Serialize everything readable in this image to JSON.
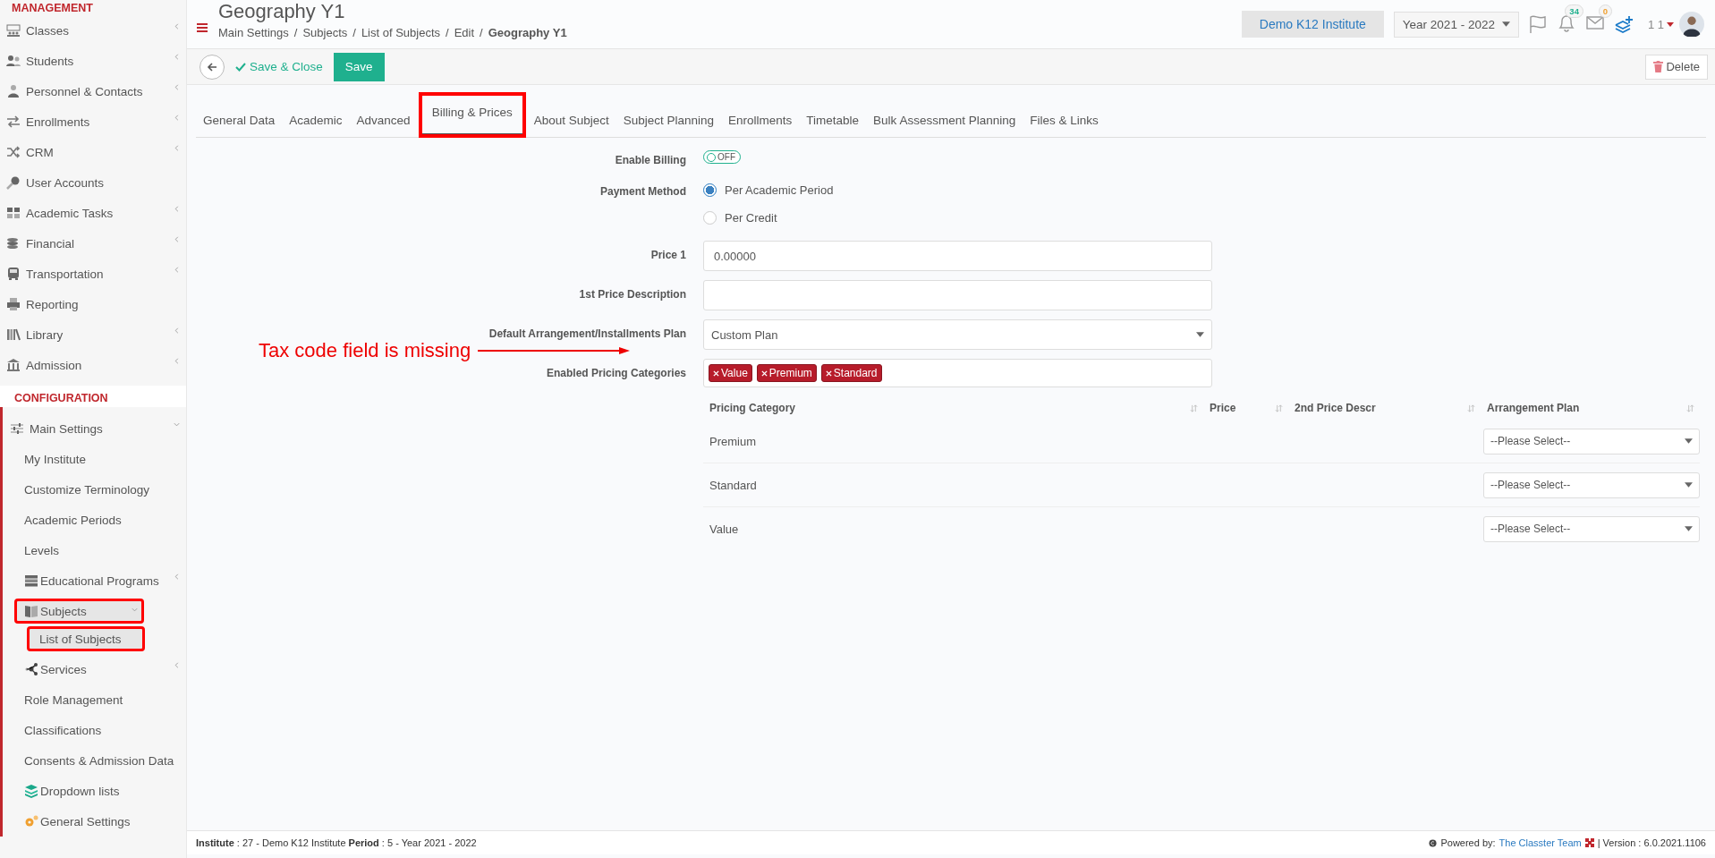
{
  "sidebar": {
    "sections": [
      {
        "title": "MANAGEMENT",
        "items": [
          {
            "label": "Classes",
            "has_icon": true,
            "submenu": true,
            "expanded": false,
            "selected": false,
            "highlighted": false
          },
          {
            "label": "Students",
            "has_icon": true,
            "submenu": true,
            "expanded": false,
            "selected": false,
            "highlighted": false
          },
          {
            "label": "Personnel & Contacts",
            "has_icon": true,
            "submenu": true,
            "expanded": false,
            "selected": false,
            "highlighted": false
          },
          {
            "label": "Enrollments",
            "has_icon": true,
            "submenu": true,
            "expanded": false,
            "selected": false,
            "highlighted": false
          },
          {
            "label": "CRM",
            "has_icon": true,
            "submenu": true,
            "expanded": false,
            "selected": false,
            "highlighted": false
          },
          {
            "label": "User Accounts",
            "has_icon": true,
            "submenu": false,
            "expanded": false,
            "selected": false,
            "highlighted": false
          },
          {
            "label": "Academic Tasks",
            "has_icon": true,
            "submenu": true,
            "expanded": false,
            "selected": false,
            "highlighted": false
          },
          {
            "label": "Financial",
            "has_icon": true,
            "submenu": true,
            "expanded": false,
            "selected": false,
            "highlighted": false
          },
          {
            "label": "Transportation",
            "has_icon": true,
            "submenu": true,
            "expanded": false,
            "selected": false,
            "highlighted": false
          },
          {
            "label": "Reporting",
            "has_icon": true,
            "submenu": false,
            "expanded": false,
            "selected": false,
            "highlighted": false
          },
          {
            "label": "Library",
            "has_icon": true,
            "submenu": true,
            "expanded": false,
            "selected": false,
            "highlighted": false
          },
          {
            "label": "Admission",
            "has_icon": true,
            "submenu": true,
            "expanded": false,
            "selected": false,
            "highlighted": false
          }
        ]
      },
      {
        "title": "CONFIGURATION",
        "items": [
          {
            "label": "Main Settings",
            "has_icon": true,
            "submenu": true,
            "expanded": true,
            "selected": false,
            "highlighted": false,
            "children": [
              {
                "label": "My Institute",
                "has_icon": false,
                "submenu": false,
                "expanded": false,
                "selected": false,
                "highlighted": false
              },
              {
                "label": "Customize Terminology",
                "has_icon": false,
                "submenu": false,
                "expanded": false,
                "selected": false,
                "highlighted": false
              },
              {
                "label": "Academic Periods",
                "has_icon": false,
                "submenu": false,
                "expanded": false,
                "selected": false,
                "highlighted": false
              },
              {
                "label": "Levels",
                "has_icon": false,
                "submenu": false,
                "expanded": false,
                "selected": false,
                "highlighted": false
              },
              {
                "label": "Educational Programs",
                "has_icon": true,
                "submenu": true,
                "expanded": false,
                "selected": false,
                "highlighted": false
              },
              {
                "label": "Subjects",
                "has_icon": true,
                "submenu": true,
                "expanded": true,
                "selected": true,
                "highlighted": true,
                "children": [
                  {
                    "label": "List of Subjects",
                    "has_icon": false,
                    "submenu": false,
                    "expanded": false,
                    "selected": true,
                    "highlighted": true
                  }
                ]
              },
              {
                "label": "Services",
                "has_icon": true,
                "submenu": true,
                "expanded": false,
                "selected": false,
                "highlighted": false
              },
              {
                "label": "Role Management",
                "has_icon": false,
                "submenu": false,
                "expanded": false,
                "selected": false,
                "highlighted": false
              },
              {
                "label": "Classifications",
                "has_icon": false,
                "submenu": false,
                "expanded": false,
                "selected": false,
                "highlighted": false
              },
              {
                "label": "Consents & Admission Data",
                "has_icon": false,
                "submenu": false,
                "expanded": false,
                "selected": false,
                "highlighted": false
              },
              {
                "label": "Dropdown lists",
                "has_icon": true,
                "submenu": false,
                "expanded": false,
                "selected": false,
                "highlighted": false
              },
              {
                "label": "General Settings",
                "has_icon": true,
                "submenu": false,
                "expanded": false,
                "selected": false,
                "highlighted": false
              }
            ]
          }
        ]
      }
    ]
  },
  "header": {
    "title": "Geography Y1",
    "breadcrumb": [
      "Main Settings",
      "Subjects",
      "List of Subjects",
      "Edit",
      "Geography Y1"
    ],
    "breadcrumb_separator": "/",
    "institute": "Demo K12 Institute",
    "year": "Year 2021 - 2022",
    "notifications": "34",
    "messages": "0",
    "user": "1 1"
  },
  "toolbar": {
    "save_close": "Save & Close",
    "save": "Save",
    "delete": "Delete"
  },
  "tabs": [
    {
      "label": "General Data",
      "selected": false,
      "highlighted": false
    },
    {
      "label": "Academic",
      "selected": false,
      "highlighted": false
    },
    {
      "label": "Advanced",
      "selected": false,
      "highlighted": false
    },
    {
      "label": "Billing & Prices",
      "selected": true,
      "highlighted": true
    },
    {
      "label": "About Subject",
      "selected": false,
      "highlighted": false
    },
    {
      "label": "Subject Planning",
      "selected": false,
      "highlighted": false
    },
    {
      "label": "Enrollments",
      "selected": false,
      "highlighted": false
    },
    {
      "label": "Timetable",
      "selected": false,
      "highlighted": false
    },
    {
      "label": "Bulk Assessment Planning",
      "selected": false,
      "highlighted": false
    },
    {
      "label": "Files & Links",
      "selected": false,
      "highlighted": false
    }
  ],
  "form": [
    {
      "kind": "toggle",
      "label": "Enable Billing",
      "on": false,
      "state_text": "OFF"
    },
    {
      "kind": "radio",
      "label": "Payment Method",
      "options": [
        {
          "label": "Per Academic Period",
          "selected": true
        },
        {
          "label": "Per Credit",
          "selected": false
        }
      ]
    },
    {
      "kind": "text",
      "label": "Price 1",
      "value": "0.00000"
    },
    {
      "kind": "text",
      "label": "1st Price Description"
    },
    {
      "kind": "select",
      "label": "Default Arrangement/Installments Plan",
      "value": "Custom Plan"
    },
    {
      "kind": "tags",
      "label": "Enabled Pricing Categories",
      "tags": [
        "Value",
        "Premium",
        "Standard"
      ]
    }
  ],
  "annotation": {
    "text": "Tax code field is missing"
  },
  "pricing_table": {
    "columns": [
      "Pricing Category",
      "Price",
      "2nd Price Descr",
      "Arrangement Plan"
    ],
    "rows": [
      {
        "category": "Premium",
        "arrangement_placeholder": "--Please Select--"
      },
      {
        "category": "Standard",
        "arrangement_placeholder": "--Please Select--"
      },
      {
        "category": "Value",
        "arrangement_placeholder": "--Please Select--"
      }
    ]
  },
  "footer": {
    "info": "**Institute** : 27 - Demo K12 Institute **Period** : 5 - Year 2021 - 2022",
    "powered_by": "Powered by:",
    "team_link": "The Classter Team",
    "version": "| Version : 6.0.2021.1106"
  }
}
